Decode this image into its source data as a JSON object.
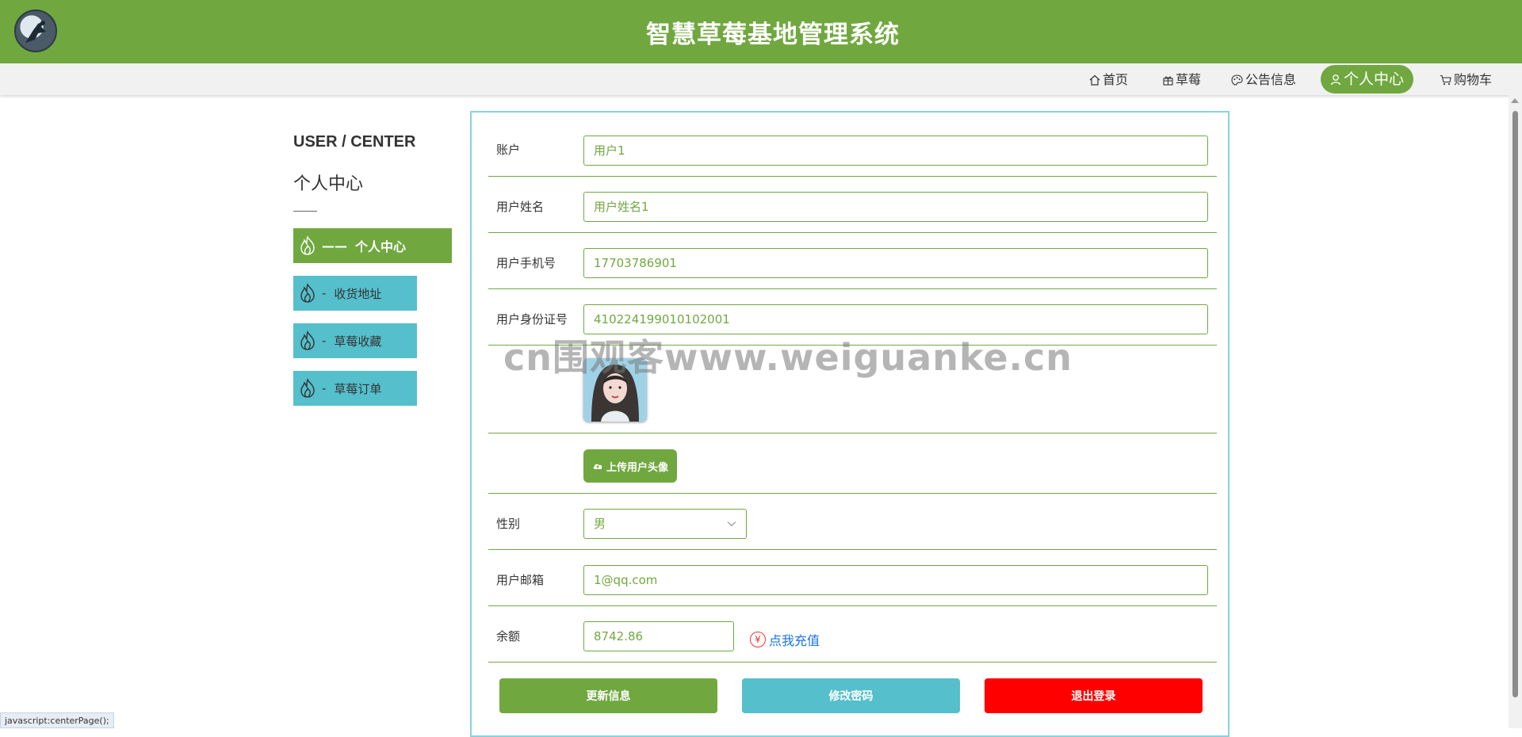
{
  "header": {
    "title": "智慧草莓基地管理系统"
  },
  "nav": {
    "items": [
      {
        "label": "首页",
        "icon": "home-icon"
      },
      {
        "label": "草莓",
        "icon": "gift-icon"
      },
      {
        "label": "公告信息",
        "icon": "palette-icon"
      },
      {
        "label": "个人中心",
        "icon": "user-icon",
        "active": true
      },
      {
        "label": "购物车",
        "icon": "cart-icon"
      }
    ]
  },
  "sidebar": {
    "title_en": "USER / CENTER",
    "title_cn": "个人中心",
    "items": [
      {
        "label": "个人中心",
        "dash": "——",
        "active": true
      },
      {
        "label": "收货地址",
        "dash": "-"
      },
      {
        "label": "草莓收藏",
        "dash": "-"
      },
      {
        "label": "草莓订单",
        "dash": "-"
      }
    ]
  },
  "form": {
    "account": {
      "label": "账户",
      "value": "用户1"
    },
    "name": {
      "label": "用户姓名",
      "value": "用户姓名1"
    },
    "phone": {
      "label": "用户手机号",
      "value": "17703786901"
    },
    "id_card": {
      "label": "用户身份证号",
      "value": "410224199010102001"
    },
    "upload_label": "上传用户头像",
    "gender": {
      "label": "性别",
      "value": "男"
    },
    "email": {
      "label": "用户邮箱",
      "value": "1@qq.com"
    },
    "balance": {
      "label": "余额",
      "value": "8742.86",
      "recharge": "点我充值",
      "currency_symbol": "¥"
    }
  },
  "buttons": {
    "update": "更新信息",
    "password": "修改密码",
    "logout": "退出登录"
  },
  "colors": {
    "brand_green": "#70a83f",
    "teal": "#55bfcc",
    "logout_red": "#ff0000",
    "link_blue": "#1a73e8"
  },
  "watermark": "cn围观客www.weiguanke.cn",
  "statusbar": "javascript:centerPage();"
}
